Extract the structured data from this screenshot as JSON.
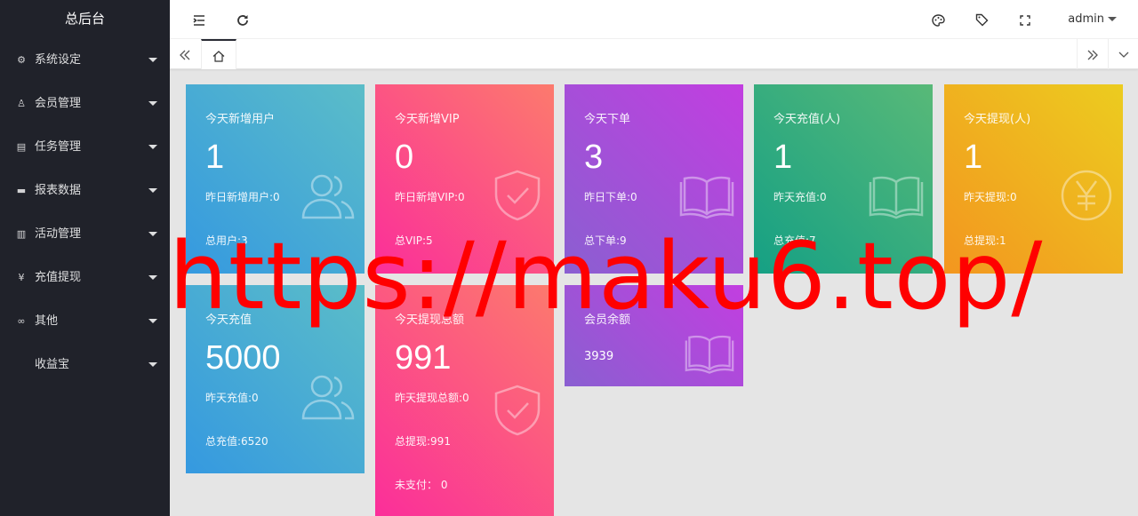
{
  "sidebar": {
    "brand": "总后台",
    "items": [
      {
        "label": "系统设定",
        "icon": "gear-icon",
        "glyph": "⚙"
      },
      {
        "label": "会员管理",
        "icon": "user-icon",
        "glyph": "♙"
      },
      {
        "label": "任务管理",
        "icon": "document-icon",
        "glyph": "▤"
      },
      {
        "label": "报表数据",
        "icon": "monitor-icon",
        "glyph": "▬"
      },
      {
        "label": "活动管理",
        "icon": "book-icon",
        "glyph": "▥"
      },
      {
        "label": "充值提现",
        "icon": "yen-icon",
        "glyph": "¥"
      },
      {
        "label": "其他",
        "icon": "link-icon",
        "glyph": "∞"
      },
      {
        "label": "收益宝",
        "icon": "",
        "glyph": ""
      }
    ]
  },
  "topbar": {
    "admin": "admin"
  },
  "watermark": "https://maku6.top/",
  "cards": {
    "new_users": {
      "title": "今天新增用户",
      "value": "1",
      "sub": "昨日新增用户:0",
      "total": "总用户:3"
    },
    "new_vip": {
      "title": "今天新增VIP",
      "value": "0",
      "sub": "昨日新增VIP:0",
      "total": "总VIP:5"
    },
    "orders": {
      "title": "今天下单",
      "value": "3",
      "sub": "昨日下单:0",
      "total": "总下单:9"
    },
    "recharge_people": {
      "title": "今天充值(人)",
      "value": "1",
      "sub": "昨天充值:0",
      "total": "总充值:7"
    },
    "withdraw_people": {
      "title": "今天提现(人)",
      "value": "1",
      "sub": "昨天提现:0",
      "total": "总提现:1"
    },
    "recharge": {
      "title": "今天充值",
      "value": "5000",
      "sub": "昨天充值:0",
      "total": "总充值:6520"
    },
    "withdraw_amount": {
      "title": "今天提现总额",
      "value": "991",
      "sub": "昨天提现总额:0",
      "total": "总提现:991",
      "extra": "未支付： 0"
    },
    "balance": {
      "title": "会员余额",
      "value": "3939"
    }
  },
  "colors": {
    "sidebar_bg": "#20222a",
    "blue": "#3599e0",
    "pink": "#fb2e9a",
    "purple": "#a94ed8",
    "green": "#15a084",
    "orange": "#f3961f",
    "watermark": "#ff0000"
  }
}
